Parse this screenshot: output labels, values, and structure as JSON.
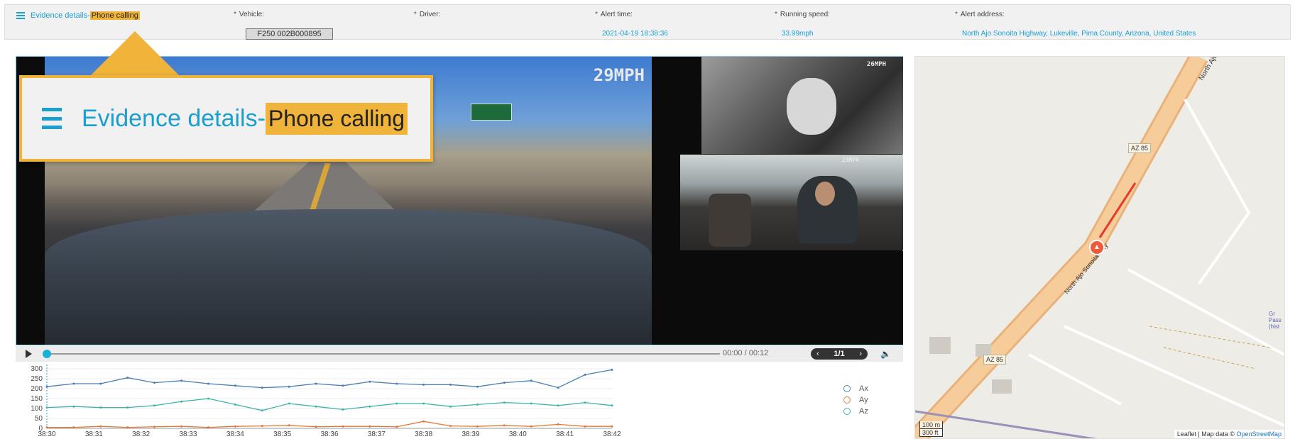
{
  "header": {
    "title": "Evidence details-",
    "alert_type": "Phone calling",
    "fields": {
      "vehicle": {
        "label": "Vehicle:",
        "value": "F250 002B000895"
      },
      "driver": {
        "label": "Driver:",
        "value": ""
      },
      "alert_time": {
        "label": "Alert time:",
        "value": "2021-04-19 18:38:36"
      },
      "running_speed": {
        "label": "Running speed:",
        "value": "33.99mph"
      },
      "alert_address": {
        "label": "Alert address:",
        "value": "North Ajo Sonoita Highway, Lukeville, Pima County, Arizona, United States"
      }
    }
  },
  "callout": {
    "title": "Evidence details-",
    "alert_type": "Phone calling"
  },
  "video": {
    "main_speed_overlay": "29MPH",
    "side_top_speed_overlay": "26MPH",
    "side_mid_speed_overlay": "29MPH",
    "time_display": "00:00 / 00:12",
    "pager": "1/1",
    "progress_fraction": 0.0
  },
  "chart_data": {
    "type": "line",
    "x": [
      "38:30",
      "38:31",
      "38:32",
      "38:33",
      "38:34",
      "38:35",
      "38:36",
      "38:37",
      "38:38",
      "38:39",
      "38:40",
      "38:41",
      "38:42"
    ],
    "ylim": [
      0,
      300
    ],
    "yticks": [
      "0",
      "50",
      "100",
      "150",
      "200",
      "250",
      "300"
    ],
    "series": [
      {
        "name": "Ax",
        "color": "#4a7fb5",
        "values": [
          210,
          225,
          225,
          255,
          230,
          240,
          225,
          215,
          205,
          210,
          225,
          215,
          235,
          225,
          220,
          220,
          210,
          230,
          240,
          205,
          270,
          295
        ]
      },
      {
        "name": "Ay",
        "color": "#e07a3a",
        "values": [
          5,
          5,
          10,
          5,
          8,
          10,
          5,
          10,
          12,
          15,
          8,
          10,
          10,
          8,
          35,
          12,
          10,
          15,
          10,
          20,
          10,
          10
        ]
      },
      {
        "name": "Az",
        "color": "#3fb3a7",
        "values": [
          105,
          110,
          105,
          105,
          115,
          135,
          150,
          120,
          90,
          125,
          110,
          95,
          110,
          125,
          125,
          110,
          120,
          130,
          125,
          115,
          130,
          115
        ]
      }
    ]
  },
  "map": {
    "road_label_top": "North Ajo Sonoita",
    "road_label_mid": "North Ajo Sonoita Hwy",
    "shield_1": "AZ 85",
    "shield_2": "AZ 85",
    "side_label": "Gr Pass (hist",
    "scale_top": "100 m",
    "scale_bottom": "300 ft",
    "attribution_prefix": "Leaflet | Map data © ",
    "attribution_link": "OpenStreetMap"
  }
}
